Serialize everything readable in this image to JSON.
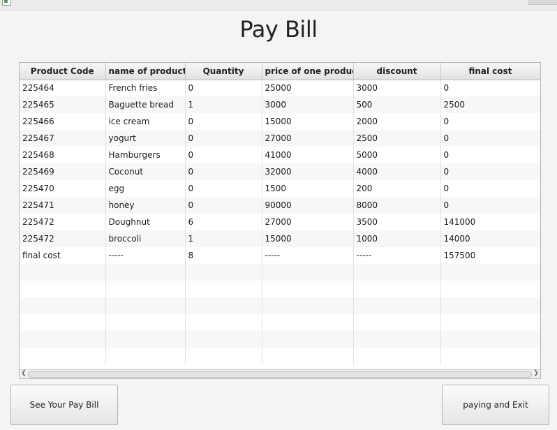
{
  "window": {
    "title": ""
  },
  "page": {
    "title": "Pay Bill"
  },
  "table": {
    "columns": [
      "Product Code",
      "name of product",
      "Quantity",
      "price of one product",
      "discount",
      "final cost"
    ],
    "rows": [
      [
        "225464",
        "French fries",
        "0",
        "25000",
        "3000",
        "0"
      ],
      [
        "225465",
        "Baguette bread",
        "1",
        "3000",
        "500",
        "2500"
      ],
      [
        "225466",
        "ice cream",
        "0",
        "15000",
        "2000",
        "0"
      ],
      [
        "225467",
        "yogurt",
        "0",
        "27000",
        "2500",
        "0"
      ],
      [
        "225468",
        "Hamburgers",
        "0",
        "41000",
        "5000",
        "0"
      ],
      [
        "225469",
        "Coconut",
        "0",
        "32000",
        "4000",
        "0"
      ],
      [
        "225470",
        "egg",
        "0",
        "1500",
        "200",
        "0"
      ],
      [
        "225471",
        "honey",
        "0",
        "90000",
        "8000",
        "0"
      ],
      [
        "225472",
        "Doughnut",
        "6",
        "27000",
        "3500",
        "141000"
      ],
      [
        "225472",
        "broccoli",
        "1",
        "15000",
        "1000",
        "14000"
      ],
      [
        "final cost",
        "-----",
        "8",
        "-----",
        "-----",
        "157500"
      ]
    ]
  },
  "buttons": {
    "see_bill": "See Your Pay Bill",
    "pay_exit": "paying and Exit"
  }
}
